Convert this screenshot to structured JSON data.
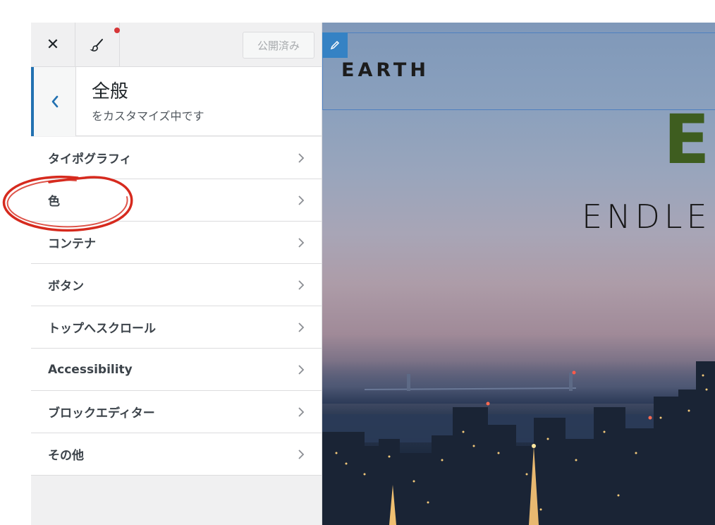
{
  "topbar": {
    "close_icon": "close-icon",
    "customize_icon": "paintbrush-icon",
    "publish_label": "公開済み",
    "accent_dot_color": "#d63638"
  },
  "section": {
    "title": "全般",
    "subtitle": "をカスタマイズ中です",
    "back_icon": "chevron-left-icon",
    "accent_color": "#2271b1"
  },
  "menu": {
    "items": [
      {
        "label": "タイポグラフィ"
      },
      {
        "label": "色"
      },
      {
        "label": "コンテナ"
      },
      {
        "label": "ボタン"
      },
      {
        "label": "トップへスクロール"
      },
      {
        "label": "Accessibility"
      },
      {
        "label": "ブロックエディター"
      },
      {
        "label": "その他"
      }
    ]
  },
  "preview": {
    "site_title": "EARTH",
    "hero_letter": "E",
    "hero_subtitle": "ENDLE",
    "edit_icon": "pencil-icon",
    "hero_letter_color": "#3e5d1f"
  },
  "annotation": {
    "shape": "red-circle-around-色",
    "color": "#d62a1e"
  }
}
